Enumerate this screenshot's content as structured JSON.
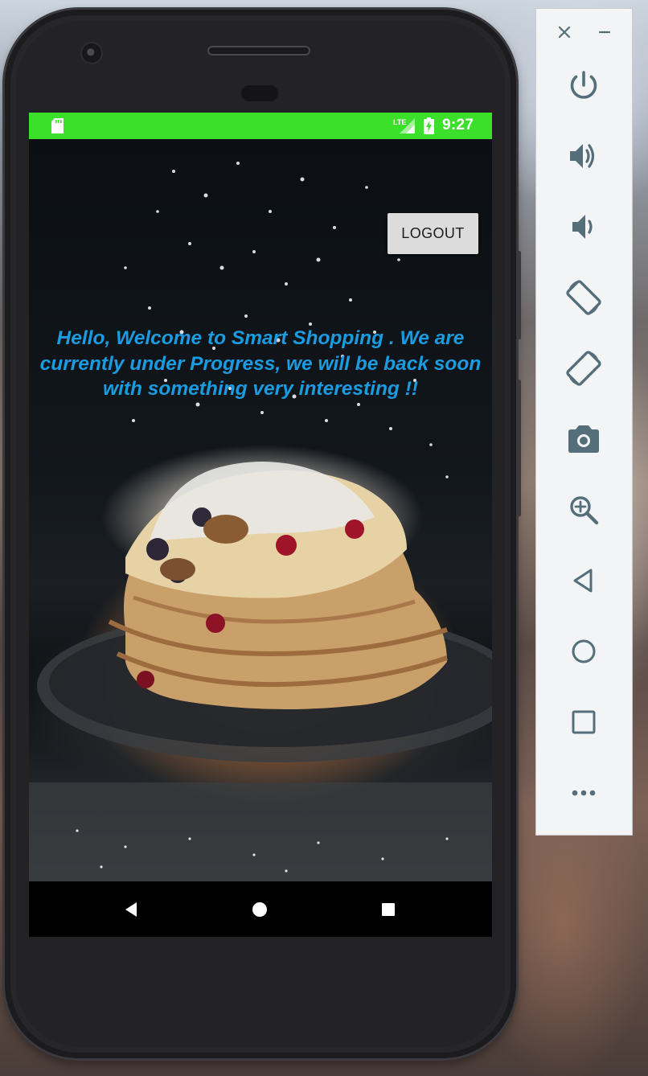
{
  "status_bar": {
    "time": "9:27",
    "network_label": "LTE",
    "background_color": "#3be02a",
    "icons": [
      "sd-card-icon",
      "lte-signal-icon",
      "battery-charging-icon"
    ]
  },
  "app": {
    "logout_label": "LOGOUT",
    "message": "Hello, Welcome to Smart Shopping . We are currently under Progress, we will be back soon with something very interesting !!",
    "message_color": "#1b9be0",
    "background_description_icon": "pancake-stack-photo"
  },
  "nav_bar": {
    "buttons": [
      "back-icon",
      "home-icon",
      "recents-icon"
    ]
  },
  "emulator_panel": {
    "window_controls": [
      "close-icon",
      "minimize-icon"
    ],
    "tools": [
      "power-icon",
      "volume-up-icon",
      "volume-down-icon",
      "rotate-left-icon",
      "rotate-right-icon",
      "camera-icon",
      "zoom-icon",
      "back-icon",
      "home-icon",
      "overview-icon",
      "more-icon"
    ],
    "icon_color": "#546e7a"
  }
}
